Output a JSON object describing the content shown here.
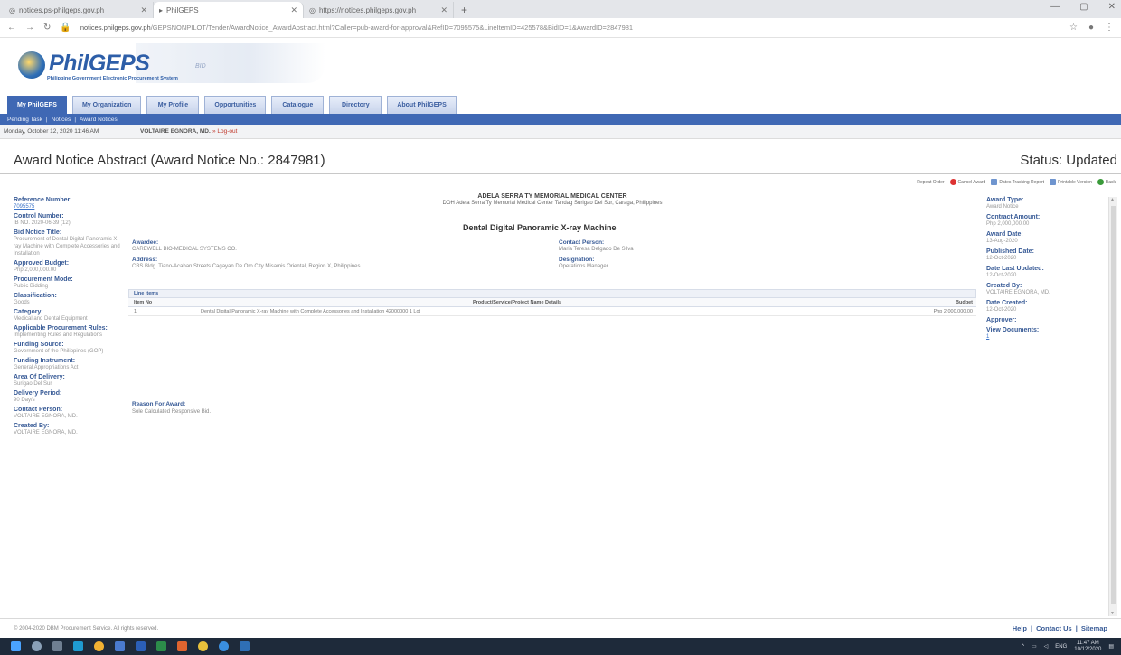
{
  "browser": {
    "tabs": [
      {
        "label": "notices.ps-philgeps.gov.ph"
      },
      {
        "label": "PhilGEPS"
      },
      {
        "label": "https://notices.philgeps.gov.ph"
      }
    ],
    "new_tab": "+",
    "url_host": "notices.philgeps.gov.ph",
    "url_path": "/GEPSNONPILOT/Tender/AwardNotice_AwardAbstract.html?Caller=pub-award-for-approval&RefID=7095575&LineItemID=425578&BidID=1&AwardID=2847981"
  },
  "header": {
    "logo_text": "PhilGEPS",
    "logo_sub": "Philippine Government Electronic Procurement System",
    "band_text": "BID"
  },
  "nav": {
    "tabs": [
      "My PhilGEPS",
      "My Organization",
      "My Profile",
      "Opportunities",
      "Catalogue",
      "Directory",
      "About PhilGEPS"
    ],
    "sub": [
      "Pending Task",
      "Notices",
      "Award Notices"
    ]
  },
  "infobar": {
    "date": "Monday, October 12, 2020 11:46 AM",
    "user": "VOLTAIRE EGNORA, MD.",
    "logout": "» Log-out"
  },
  "page": {
    "title": "Award Notice Abstract (Award Notice No.: 2847981)",
    "status": "Status: Updated"
  },
  "actions": [
    "Repeat Order",
    "Cancel Award",
    "Dates Tracking Report",
    "Printable Version",
    "Back"
  ],
  "left": [
    {
      "label": "Reference Number:",
      "value": "7095575",
      "link": true
    },
    {
      "label": "Control Number:",
      "value": "IB NO. 2020-06-39 (12)"
    },
    {
      "label": "Bid Notice Title:",
      "value": "Procurement of Dental Digital Panoramic X-ray Machine with Complete Accessories and Installation"
    },
    {
      "label": "Approved Budget:",
      "value": "Php 2,000,000.00"
    },
    {
      "label": "Procurement Mode:",
      "value": "Public Bidding"
    },
    {
      "label": "Classification:",
      "value": "Goods"
    },
    {
      "label": "Category:",
      "value": "Medical and Dental Equipment"
    },
    {
      "label": "Applicable Procurement Rules:",
      "value": "Implementing Rules and Regulations"
    },
    {
      "label": "Funding Source:",
      "value": "Government of the Philippines (GOP)"
    },
    {
      "label": "Funding Instrument:",
      "value": "General Appropriations Act"
    },
    {
      "label": "Area Of Delivery:",
      "value": "Surigao Del Sur"
    },
    {
      "label": "Delivery Period:",
      "value": "90 Day/s"
    },
    {
      "label": "Contact Person:",
      "value": "VOLTAIRE EGNORA, MD."
    },
    {
      "label": "Created By:",
      "value": "VOLTAIRE EGNORA, MD."
    }
  ],
  "center": {
    "agency": "ADELA SERRA TY MEMORIAL MEDICAL CENTER",
    "agency_addr": "DOH Adela Serra Ty Memorial Medical Center Tandag Surigao Del Sur, Caraga, Philippines",
    "project": "Dental Digital Panoramic X-ray Machine",
    "awardee_label": "Awardee:",
    "awardee": "CAREWELL BIO-MEDICAL SYSTEMS CO.",
    "address_label": "Address:",
    "address": "CBS Bldg. Tiano-Acaban Streets Cagayan De Oro City Misamis Oriental, Region X, Philippines",
    "contact_label": "Contact Person:",
    "contact": "Maria Teresa Delgado De Silva",
    "designation_label": "Designation:",
    "designation": "Operations Manager",
    "line_items_title": "Line Items",
    "line_headers": [
      "Item No",
      "Product/Service/Project Name Details",
      "Budget"
    ],
    "line_rows": [
      [
        "1",
        "Dental Digital Panoramic X-ray Machine  with Complete Accessories and Installation  42000000  1 Lot",
        "Php 2,000,000.00"
      ]
    ],
    "reason_label": "Reason For Award:",
    "reason": "Sole Calculated Responsive Bid."
  },
  "right": [
    {
      "label": "Award Type:",
      "value": "Award Notice"
    },
    {
      "label": "Contract Amount:",
      "value": "Php 2,000,000.00"
    },
    {
      "label": "Award Date:",
      "value": "13-Aug-2020"
    },
    {
      "label": "Published Date:",
      "value": "12-Oct-2020"
    },
    {
      "label": "Date Last Updated:",
      "value": "12-Oct-2020"
    },
    {
      "label": "Created By:",
      "value": "VOLTAIRE EGNORA, MD."
    },
    {
      "label": "Date Created:",
      "value": "12-Oct-2020"
    },
    {
      "label": "Approver:",
      "value": ""
    },
    {
      "label": "View Documents:",
      "value": "1",
      "link": true
    }
  ],
  "footer": {
    "copyright": "© 2004-2020 DBM Procurement Service. All rights reserved.",
    "links": [
      "Help",
      "|",
      "Contact Us",
      "|",
      "Sitemap"
    ]
  },
  "taskbar": {
    "lang": "ENG",
    "time": "11:47 AM",
    "date": "10/12/2020"
  },
  "colors": {
    "nav_active": "#3f68b4",
    "label_blue": "#375a96",
    "link": "#3b73c8"
  }
}
